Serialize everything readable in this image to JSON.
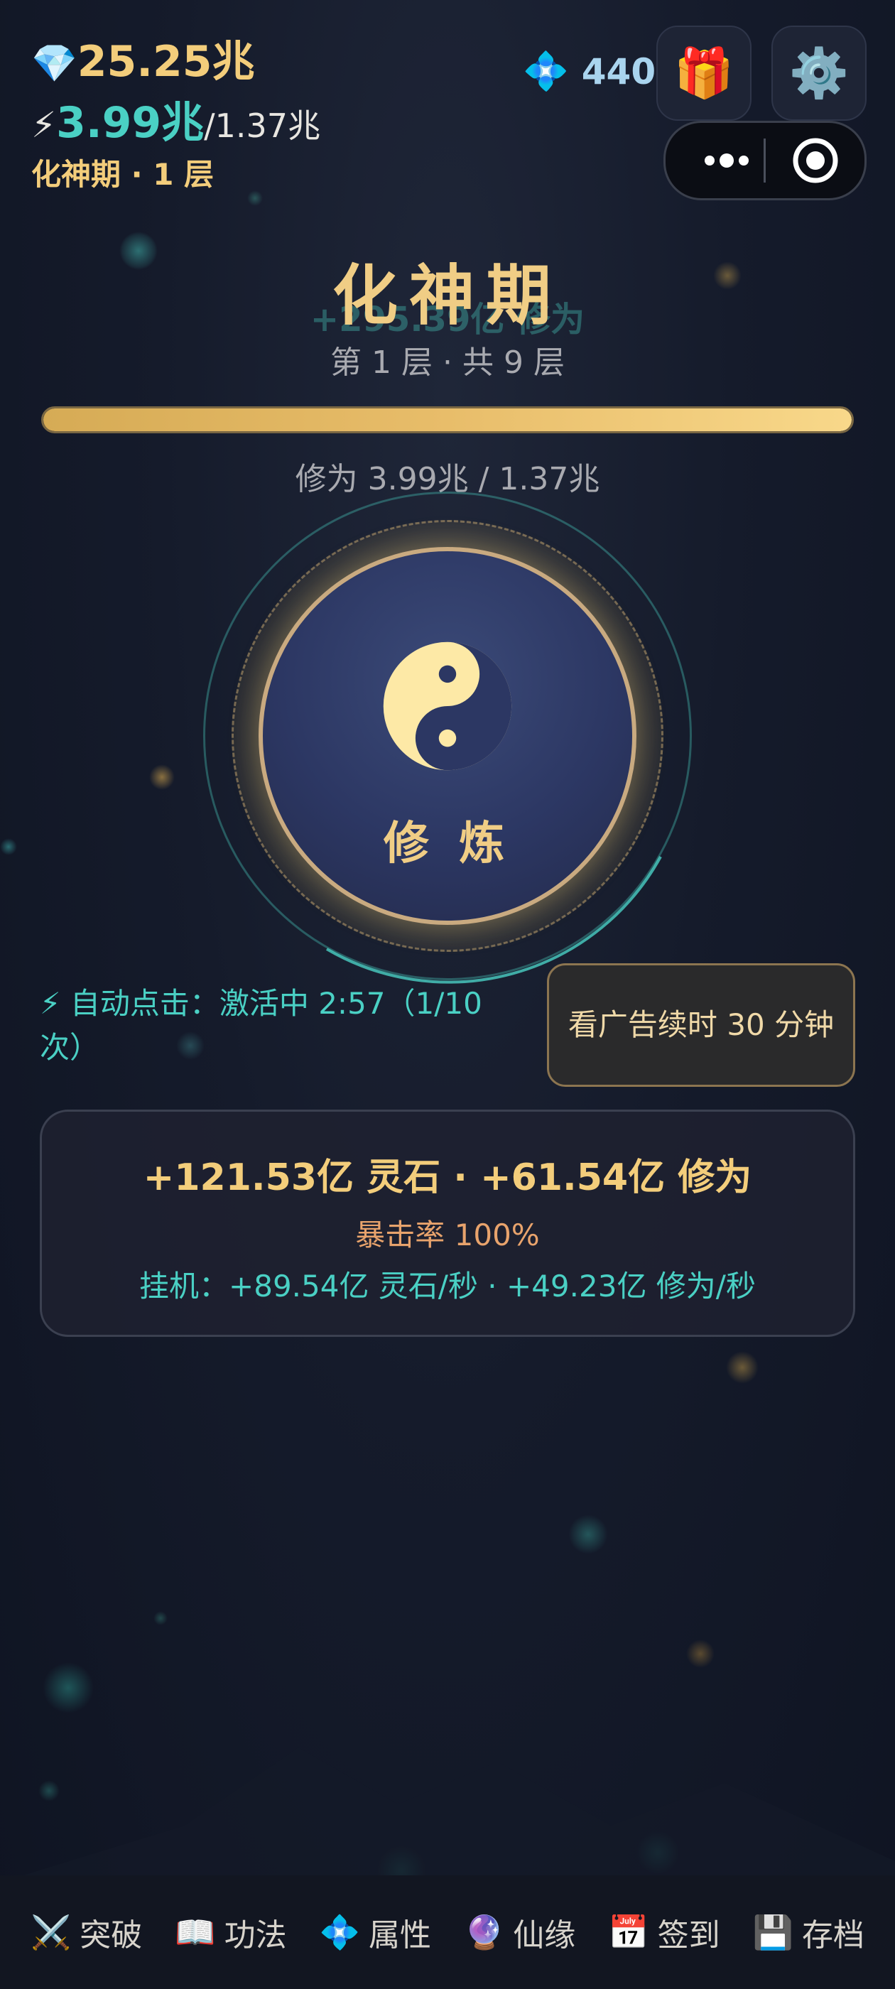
{
  "header": {
    "stones_icon": "💎",
    "stones": "25.25兆",
    "energy_icon": "⚡",
    "energy_current": "3.99兆",
    "energy_max": "/1.37兆",
    "realm_label": "化神期 · 1 层",
    "crystal_icon": "💠",
    "crystal_count": "440",
    "gift_icon": "🎁",
    "settings_icon": "⚙️"
  },
  "stage": {
    "name": "化神期",
    "float_gain": "+295.39亿 修为",
    "layer_text": "第 1 层 · 共 9 层",
    "progress_percent": 100,
    "cultivation_text": "修为 3.99兆 / 1.37兆"
  },
  "orb": {
    "button_label": "修 炼",
    "symbol": "yin-yang"
  },
  "auto_click": {
    "text": "⚡ 自动点击：激活中 2:57（1/10 次）",
    "ad_button": "看广告续时 30 分钟"
  },
  "gains": {
    "main": "+121.53亿 灵石 · +61.54亿 修为",
    "crit": "暴击率 100%",
    "idle": "挂机：+89.54亿 灵石/秒 · +49.23亿 修为/秒"
  },
  "nav": [
    {
      "icon": "⚔️",
      "label": "突破"
    },
    {
      "icon": "📖",
      "label": "功法"
    },
    {
      "icon": "💠",
      "label": "属性"
    },
    {
      "icon": "🔮",
      "label": "仙缘"
    },
    {
      "icon": "📅",
      "label": "签到"
    },
    {
      "icon": "💾",
      "label": "存档"
    }
  ],
  "colors": {
    "gold": "#f3cd7b",
    "teal": "#4ad0c4",
    "background": "#151b2b"
  }
}
